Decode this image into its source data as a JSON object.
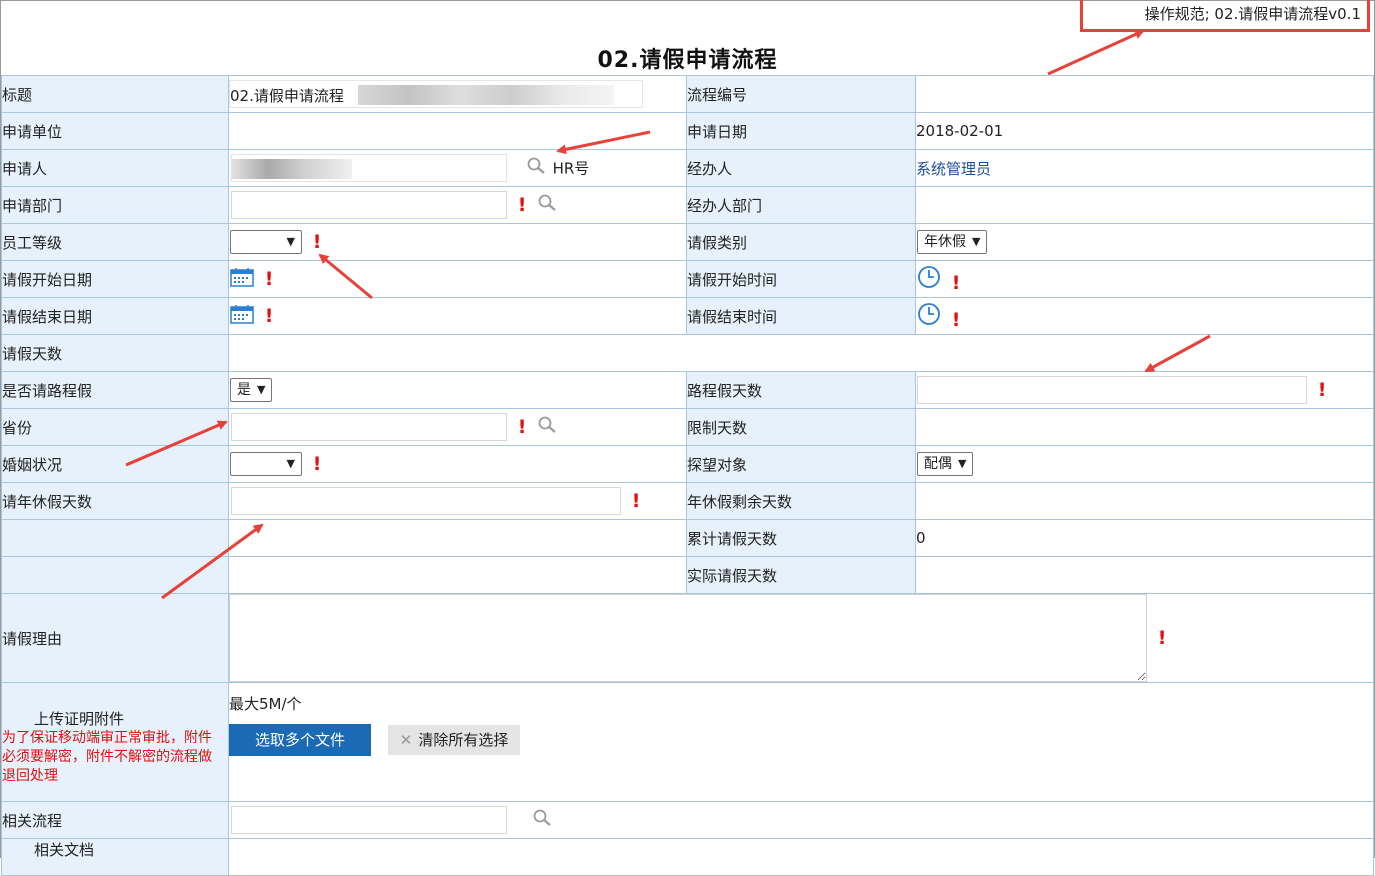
{
  "spec_label": "操作规范; 02.请假申请流程v0.1",
  "page_title": "02.请假申请流程",
  "labels": {
    "title": "标题",
    "flow_no": "流程编号",
    "unit": "申请单位",
    "apply_date": "申请日期",
    "applicant": "申请人",
    "handler": "经办人",
    "apply_dept": "申请部门",
    "handler_dept": "经办人部门",
    "staff_grade": "员工等级",
    "leave_type": "请假类别",
    "start_date": "请假开始日期",
    "start_time": "请假开始时间",
    "end_date": "请假结束日期",
    "end_time": "请假结束时间",
    "leave_days": "请假天数",
    "road_leave": "是否请路程假",
    "road_days": "路程假天数",
    "province": "省份",
    "limit_days": "限制天数",
    "marital": "婚姻状况",
    "visit_target": "探望对象",
    "annual_days": "请年休假天数",
    "annual_remaining": "年休假剩余天数",
    "cumulative": "累计请假天数",
    "actual": "实际请假天数",
    "reason": "请假理由",
    "upload": "上传证明附件",
    "related_flow": "相关流程",
    "related_doc": "相关文档"
  },
  "values": {
    "title": "02.请假申请流程",
    "apply_date": "2018-02-01",
    "hr_label": "HR号",
    "handler": "系统管理员",
    "leave_type": "年休假",
    "road_leave": "是",
    "visit_target": "配偶",
    "cumulative": "0"
  },
  "upload": {
    "note": "为了保证移动端审正常审批，附件必须要解密，附件不解密的流程做退回处理",
    "max_size": "最大5M/个",
    "select_button": "选取多个文件",
    "clear_button": "清除所有选择"
  },
  "icons": {
    "search": "magnifier-icon",
    "calendar": "calendar-icon",
    "clock": "clock-icon",
    "required": "exclamation-icon",
    "clear": "x-icon"
  },
  "colors": {
    "label_bg": "#e6f1fb",
    "border": "#a9c6e0",
    "required": "#e01010",
    "primary_button": "#1b6ab5",
    "annotation": "#e8413a"
  }
}
